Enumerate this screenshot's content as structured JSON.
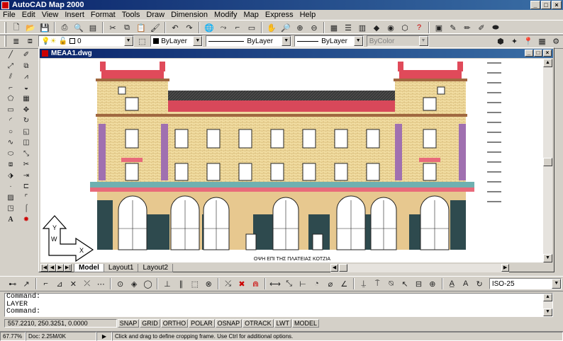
{
  "app": {
    "title": "AutoCAD Map 2000"
  },
  "menu": [
    "File",
    "Edit",
    "View",
    "Insert",
    "Format",
    "Tools",
    "Draw",
    "Dimension",
    "Modify",
    "Map",
    "Express",
    "Help"
  ],
  "layer_bar": {
    "layer_name": "0",
    "color": "ByLayer",
    "linetype": "ByLayer",
    "lineweight": "ByLayer",
    "plotstyle": "ByColor"
  },
  "drawing": {
    "title": "ΜΕΑΑ1.dwg",
    "caption": "ΟΨΗ    ΕΠΙ ΤΗΣ ΠΛΑΤΕΙΑΣ ΚΟΤΖΙΑ",
    "ucs_x": "X",
    "ucs_y": "Y",
    "ucs_w": "W"
  },
  "tabs": [
    "Model",
    "Layout1",
    "Layout2"
  ],
  "dimstyle": "ISO-25",
  "command_lines": [
    "Command:",
    "LAYER",
    "Command:"
  ],
  "status": {
    "coords": "557.2210, 250.3251, 0.0000",
    "toggles": [
      "SNAP",
      "GRID",
      "ORTHO",
      "POLAR",
      "OSNAP",
      "OTRACK",
      "LWT",
      "MODEL"
    ]
  },
  "bottom": {
    "zoom": "67.77%",
    "doc": "Doc: 2.25M/0K",
    "hint": "Click and drag to define cropping frame. Use Ctrl for additional options."
  }
}
